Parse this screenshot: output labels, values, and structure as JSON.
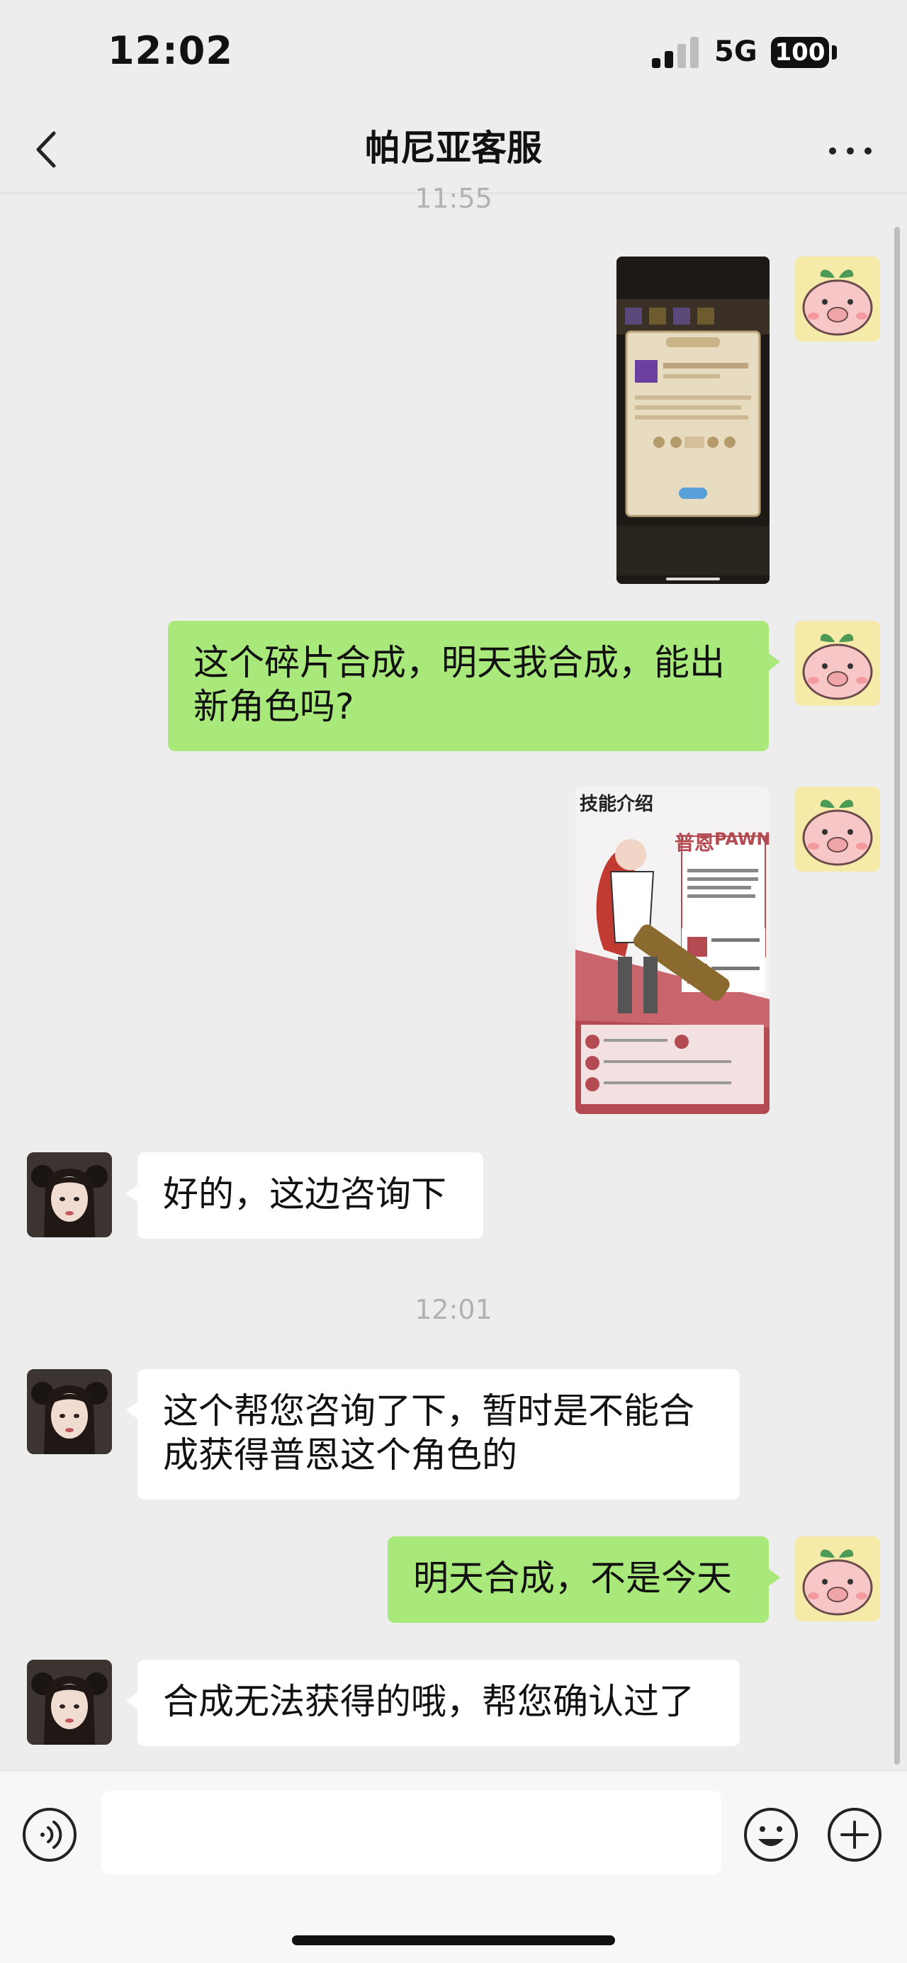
{
  "status_bar": {
    "time": "12:02",
    "network": "5G",
    "battery": "100"
  },
  "nav": {
    "title": "帕尼亚客服",
    "back_icon": "chevron-left-icon",
    "more_icon": "more-dots-icon"
  },
  "timestamps": {
    "first": "11:55",
    "second": "12:01"
  },
  "messages": {
    "m2": "这个碎片合成，明天我合成，能出\n新角色吗?",
    "m4": "好的，这边咨询下",
    "m5": "这个帮您咨询了下，暂时是不能合\n成获得普恩这个角色的",
    "m6": "明天合成，不是今天",
    "m7": "合成无法获得的哦，帮您确认过了"
  },
  "images": {
    "screenshot_icon": "game-screenshot-image",
    "poster": {
      "header": "技能介绍",
      "name_cn": "普恩",
      "name_en": "PAWN"
    }
  },
  "input_bar": {
    "placeholder": "",
    "voice_icon": "voice-icon",
    "emoji_icon": "emoji-icon",
    "plus_icon": "plus-circle-icon"
  },
  "colors": {
    "self_bubble": "#a9e87a",
    "agent_bubble": "#ffffff",
    "background": "#ededed"
  }
}
